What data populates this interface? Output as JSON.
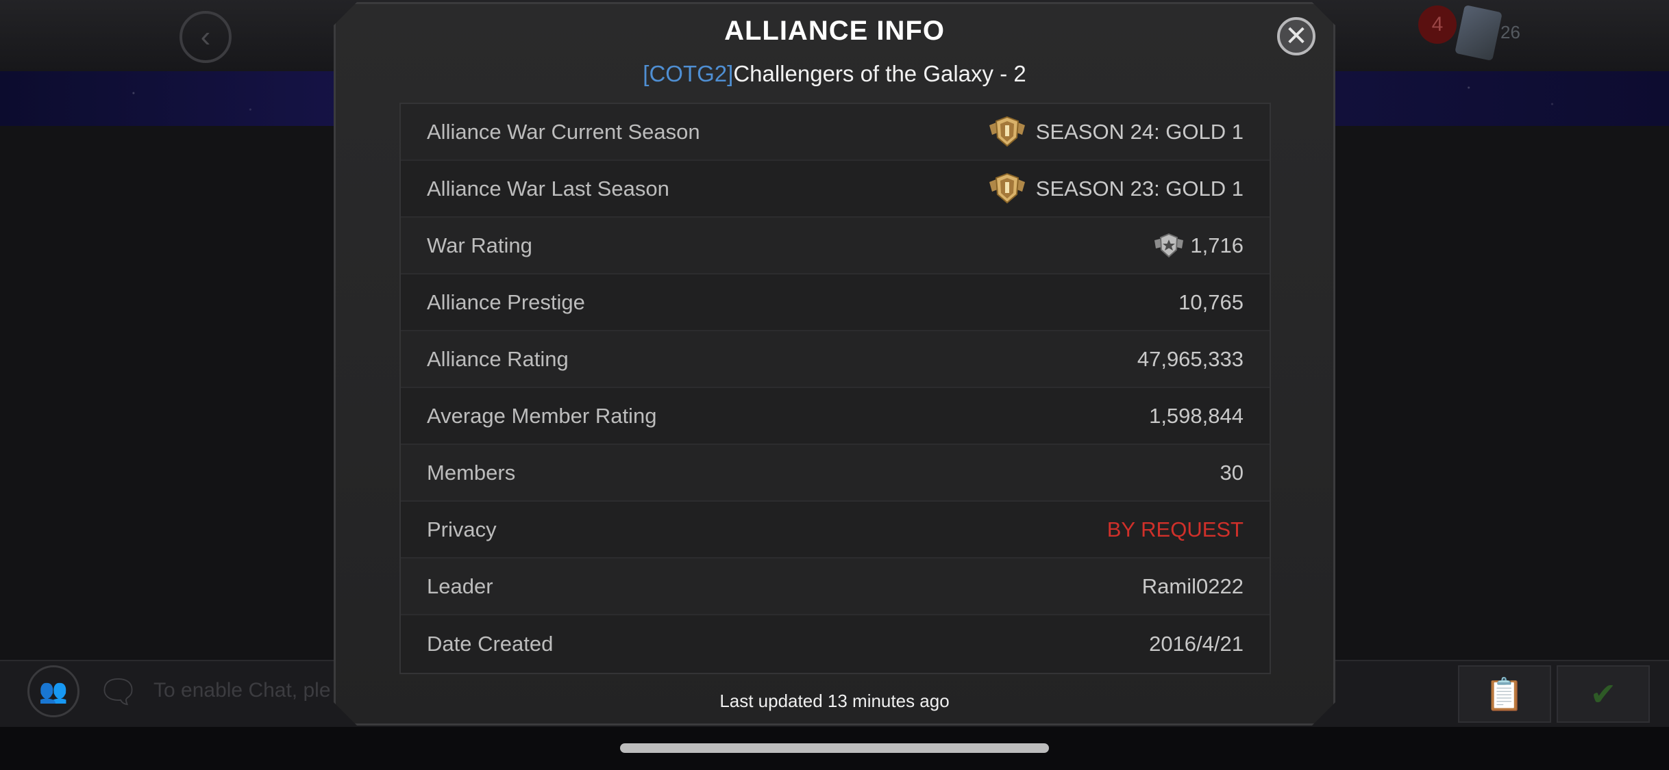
{
  "background": {
    "notification_count": "4",
    "card_count": "26",
    "chat_placeholder": "To enable Chat, ple"
  },
  "modal": {
    "title": "ALLIANCE INFO",
    "alliance_tag": "[COTG2]",
    "alliance_name": "Challengers of the Galaxy - 2",
    "close_icon": "close-icon",
    "rows": [
      {
        "label": "Alliance War Current Season",
        "value": "SEASON 24: GOLD 1",
        "icon": "gold-season-icon"
      },
      {
        "label": "Alliance War Last Season",
        "value": "SEASON 23: GOLD 1",
        "icon": "gold-season-icon"
      },
      {
        "label": "War Rating",
        "value": "1,716",
        "icon": "war-rating-icon"
      },
      {
        "label": "Alliance Prestige",
        "value": "10,765"
      },
      {
        "label": "Alliance Rating",
        "value": "47,965,333"
      },
      {
        "label": "Average Member Rating",
        "value": "1,598,844"
      },
      {
        "label": "Members",
        "value": "30"
      },
      {
        "label": "Privacy",
        "value": "BY REQUEST",
        "value_color": "#d0302a"
      },
      {
        "label": "Leader",
        "value": "Ramil0222"
      },
      {
        "label": "Date Created",
        "value": "2016/4/21"
      }
    ],
    "footer": "Last updated 13 minutes ago"
  },
  "colors": {
    "tag_blue": "#4f8fd3",
    "privacy_red": "#d0302a",
    "gold": "#c9a25a"
  }
}
